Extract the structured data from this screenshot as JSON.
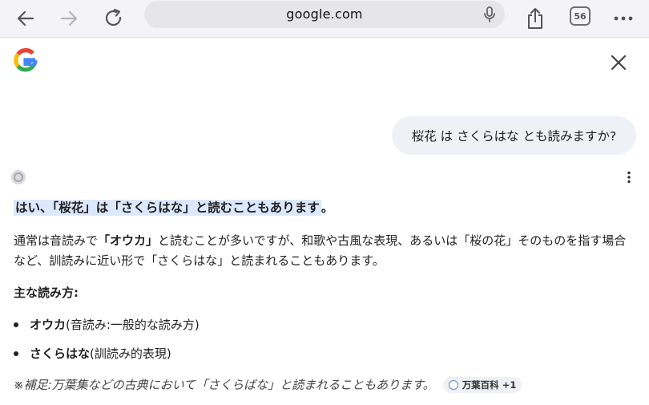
{
  "browser": {
    "url": "google.com",
    "tab_count": "56"
  },
  "chat": {
    "user_message": "桜花 は さくらはな とも読みますか?",
    "headline": "はい、「桜花」は「さくらはな」と読むこともあります",
    "headline_end": "。",
    "para_part1": "通常は音読みで",
    "para_bold": "「オウカ」",
    "para_part2": "と読むことが多いですが、和歌や古風な表現、あるいは「桜の花」そのものを指す場合など、訓読みに近い形で「さくらはな」と読まれることもあります。",
    "section_title": "主な読み方:",
    "bullets": [
      {
        "term": "オウカ",
        "desc": "(音読み:一般的な読み方)"
      },
      {
        "term": "さくらはな",
        "desc": "(訓読み的表現)"
      }
    ],
    "note": "※補足:万葉集などの古典において「さくらばな」と読まれることもあります。",
    "source_chip": "万葉百科 +1"
  }
}
